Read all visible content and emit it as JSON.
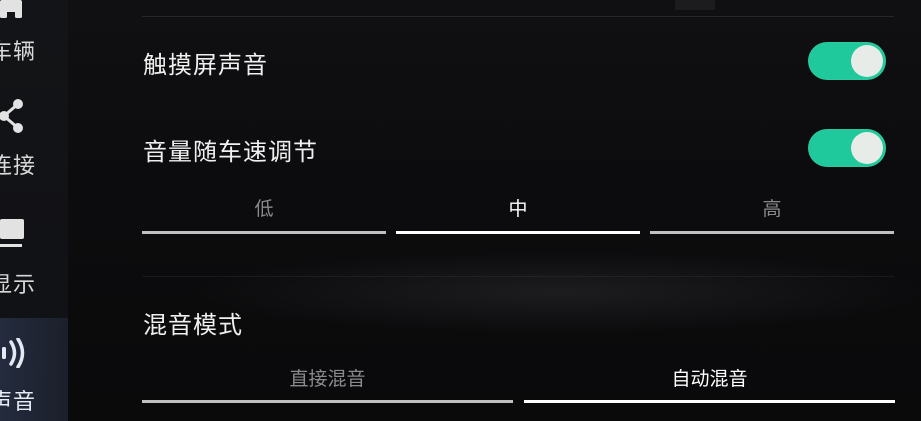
{
  "sidebar": {
    "items": [
      {
        "label": "车辆",
        "icon": "car-icon"
      },
      {
        "label": "连接",
        "icon": "share-icon"
      },
      {
        "label": "显示",
        "icon": "monitor-icon"
      },
      {
        "label": "声音",
        "icon": "sound-icon",
        "active": true
      }
    ]
  },
  "settings": {
    "touch_sound": {
      "label": "触摸屏声音",
      "enabled": true
    },
    "speed_volume": {
      "label": "音量随车速调节",
      "enabled": true
    },
    "speed_levels": {
      "options": [
        "低",
        "中",
        "高"
      ],
      "selected": "中"
    },
    "mix_mode": {
      "label": "混音模式",
      "options": [
        "直接混音",
        "自动混音"
      ],
      "selected": "自动混音"
    }
  },
  "colors": {
    "toggle_on": "#1fc99b",
    "background": "#0b0b0c"
  }
}
